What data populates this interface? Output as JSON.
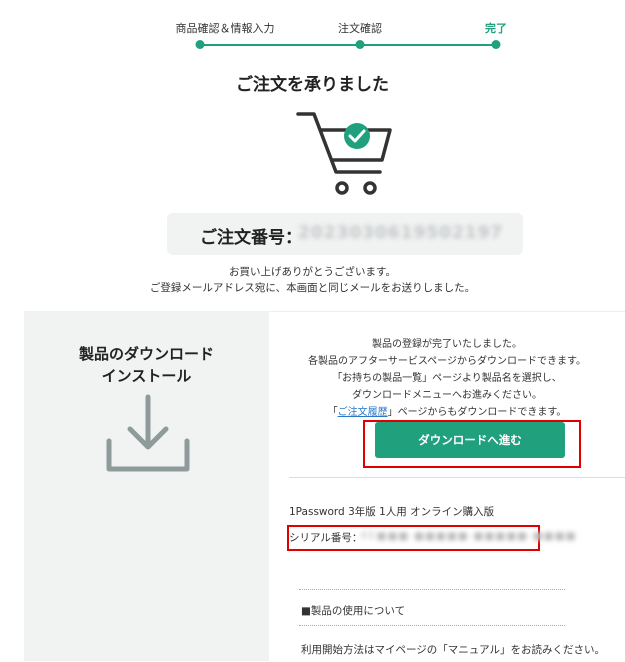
{
  "progress": {
    "steps": [
      {
        "label": "商品確認＆情報入力"
      },
      {
        "label": "注文確認"
      },
      {
        "label": "完了"
      }
    ],
    "accent": "#20a07d"
  },
  "title": "ご注文を承りました",
  "icons": {
    "cart": "shopping-cart-check-icon",
    "download": "download-icon"
  },
  "order": {
    "label": "ご注文番号：",
    "number": "20230306195021​97"
  },
  "thanks": {
    "line1": "お買い上げありがとうございます。",
    "line2": "ご登録メールアドレス宛に、本画面と同じメールをお送りしました。"
  },
  "download_panel": {
    "title_line1": "製品のダウンロード",
    "title_line2": "インストール"
  },
  "info": {
    "line1": "製品の登録が完了いたしました。",
    "line2": "各製品のアフターサービスページからダウンロードできます。",
    "line3": "「お持ちの製品一覧」ページより製品名を選択し、",
    "line4": "ダウンロードメニューへお進みください。",
    "line5_pre": "「",
    "line5_link": "ご注文履歴",
    "line5_post": "」ページからもダウンロードできます。"
  },
  "download_button": {
    "label": "ダウンロードへ進む"
  },
  "product": {
    "name": "1Password 3年版 1人用 オンライン購入版",
    "serial_label": "シリアル番号：",
    "serial_value": "KE■■■-■■■■■-■■■■■-■■■■"
  },
  "usage": {
    "heading": "■製品の使用について",
    "text": "利用開始方法はマイページの「マニュアル」をお読みください。"
  },
  "highlight_color": "#e00000"
}
